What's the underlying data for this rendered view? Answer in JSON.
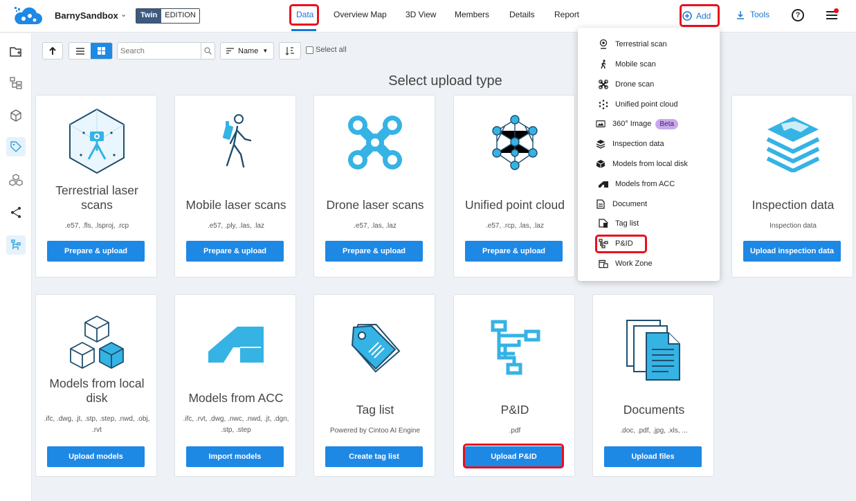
{
  "header": {
    "project_name": "BarnySandbox",
    "edition_twin": "Twin",
    "edition_label": "EDITION",
    "nav": [
      "Data",
      "Overview Map",
      "3D View",
      "Members",
      "Details",
      "Report"
    ],
    "active_tab": "Data",
    "add_label": "Add",
    "tools_label": "Tools",
    "help_glyph": "?"
  },
  "toolbar": {
    "search_placeholder": "Search",
    "sort_label": "Name",
    "select_all_label": "Select all"
  },
  "heading": "Select upload type",
  "cards": [
    {
      "title": "Terrestrial laser scans",
      "formats": ".e57, .fls, .lsproj, .rcp",
      "button": "Prepare & upload",
      "icon": "terrestrial-scanner-icon"
    },
    {
      "title": "Mobile laser scans",
      "formats": ".e57, .ply, .las, .laz",
      "button": "Prepare & upload",
      "icon": "walking-person-icon"
    },
    {
      "title": "Drone laser scans",
      "formats": ".e57, .las, .laz",
      "button": "Prepare & upload",
      "icon": "drone-icon"
    },
    {
      "title": "Unified point cloud",
      "formats": ".e57, .rcp, .las, .laz",
      "button": "Prepare & upload",
      "icon": "point-cloud-icon"
    },
    {
      "title": "Inspection data",
      "formats": "Inspection data",
      "button": "Upload inspection data",
      "icon": "layers-icon"
    },
    {
      "title": "Models from local disk",
      "formats": ".ifc, .dwg, .jt, .stp, .step, .nwd, .obj, .rvt",
      "button": "Upload models",
      "icon": "cubes-icon"
    },
    {
      "title": "Models from ACC",
      "formats": ".ifc, .rvt, .dwg, .nwc, .nwd, .jt, .dgn, .stp, .step",
      "button": "Import models",
      "icon": "acc-logo-icon"
    },
    {
      "title": "Tag list",
      "formats": "Powered by Cintoo AI Engine",
      "button": "Create tag list",
      "icon": "tag-icon"
    },
    {
      "title": "P&ID",
      "formats": ".pdf",
      "button": "Upload P&ID",
      "icon": "pid-diagram-icon"
    },
    {
      "title": "Documents",
      "formats": ".doc, .pdf, .jpg, .xls, ...",
      "button": "Upload files",
      "icon": "documents-icon"
    }
  ],
  "add_menu": {
    "items": [
      {
        "label": "Terrestrial scan",
        "icon": "scanner-icon"
      },
      {
        "label": "Mobile scan",
        "icon": "walking-icon"
      },
      {
        "label": "Drone scan",
        "icon": "drone-icon"
      },
      {
        "label": "Unified point cloud",
        "icon": "point-cloud-icon"
      },
      {
        "label": "360° Image",
        "icon": "panorama-icon",
        "badge": "Beta"
      },
      {
        "label": "Inspection data",
        "icon": "layers-icon"
      },
      {
        "label": "Models from local disk",
        "icon": "cube-icon"
      },
      {
        "label": "Models from ACC",
        "icon": "acc-icon"
      },
      {
        "label": "Document",
        "icon": "document-icon"
      },
      {
        "label": "Tag list",
        "icon": "tag-icon"
      },
      {
        "label": "P&ID",
        "icon": "pid-icon"
      },
      {
        "label": "Work Zone",
        "icon": "work-zone-icon"
      }
    ]
  },
  "colors": {
    "accent": "#1e88e5",
    "highlight": "#e8101b",
    "icon_blue": "#35b3e4",
    "icon_dark": "#1f4e6e"
  }
}
